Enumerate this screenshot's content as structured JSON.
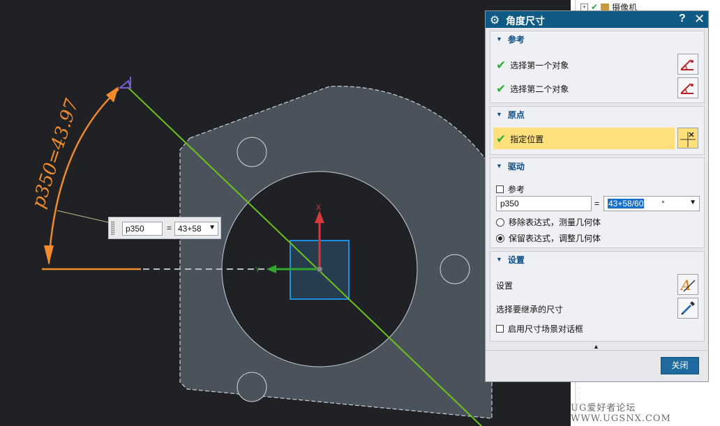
{
  "canvas": {
    "dimension_text": "p350=43.97",
    "axis_x_label": "X",
    "axis_y_label": "Y"
  },
  "inline_edit": {
    "name_value": "p350",
    "equals": "=",
    "expression_value": "43+58"
  },
  "tree_panel": {
    "expander": "+",
    "item_label": "摄像机"
  },
  "watermark": "UG爱好者论坛 WWW.UGSNX.COM",
  "dialog": {
    "title": "角度尺寸",
    "help": "?",
    "close_glyph": "✕",
    "reference": {
      "header": "参考",
      "first_object": "选择第一个对象",
      "second_object": "选择第二个对象"
    },
    "origin": {
      "header": "原点",
      "specify_location": "指定位置"
    },
    "drive": {
      "header": "驱动",
      "reference_checkbox": "参考",
      "name_field": "p350",
      "equals": "=",
      "expression_field": "43+58/60",
      "unit": "°",
      "option_remove": "移除表达式，测量几何体",
      "option_keep": "保留表达式，调整几何体",
      "selected_option": "保留表达式，调整几何体"
    },
    "settings": {
      "header": "设置",
      "settings_label": "设置",
      "inherit_label": "选择要继承的尺寸",
      "scene_dialog_checkbox": "启用尺寸场景对话框"
    },
    "close_button": "关闭"
  },
  "colors": {
    "background": "#1f2124",
    "dimension": "#f28a2e",
    "sketch_line": "#6fc21a",
    "title_bar": "#0f5b85",
    "highlight_row": "#ffe07a"
  }
}
